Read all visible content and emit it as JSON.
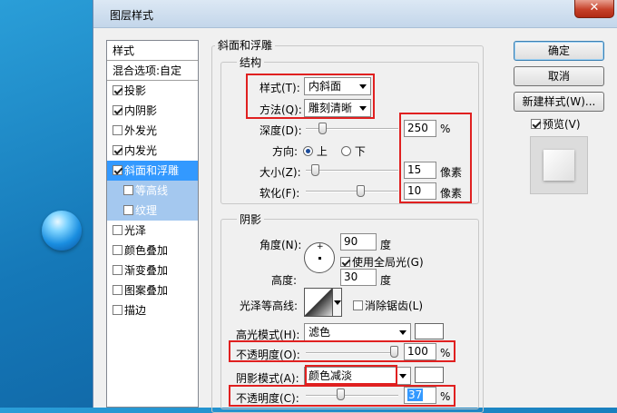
{
  "window": {
    "title": "图层样式",
    "close_label": "✕"
  },
  "style_list": {
    "header": "样式",
    "blend_label": "混合选项:自定",
    "items": [
      {
        "label": "投影",
        "checked": true
      },
      {
        "label": "内阴影",
        "checked": true
      },
      {
        "label": "外发光",
        "checked": false
      },
      {
        "label": "内发光",
        "checked": true
      },
      {
        "label": "斜面和浮雕",
        "checked": true,
        "selected": true
      },
      {
        "label": "等高线",
        "checked": false,
        "sub": true
      },
      {
        "label": "纹理",
        "checked": false,
        "sub": true
      },
      {
        "label": "光泽",
        "checked": false
      },
      {
        "label": "颜色叠加",
        "checked": false
      },
      {
        "label": "渐变叠加",
        "checked": false
      },
      {
        "label": "图案叠加",
        "checked": false
      },
      {
        "label": "描边",
        "checked": false
      }
    ]
  },
  "bevel": {
    "section_title": "斜面和浮雕",
    "structure": {
      "title": "结构",
      "style_label": "样式(T):",
      "style_value": "内斜面",
      "technique_label": "方法(Q):",
      "technique_value": "雕刻清晰",
      "depth_label": "深度(D):",
      "depth_value": "250",
      "depth_unit": "%",
      "depth_level": 0.15,
      "direction_label": "方向:",
      "dir_up": "上",
      "dir_down": "下",
      "size_label": "大小(Z):",
      "size_value": "15",
      "size_unit": "像素",
      "size_level": 0.06,
      "soften_label": "软化(F):",
      "soften_value": "10",
      "soften_unit": "像素",
      "soften_level": 0.6
    },
    "shading": {
      "title": "阴影",
      "angle_label": "角度(N):",
      "angle_value": "90",
      "angle_unit": "度",
      "global_light_label": "使用全局光(G)",
      "altitude_label": "高度:",
      "altitude_value": "30",
      "altitude_unit": "度",
      "gloss_label": "光泽等高线:",
      "antialias_label": "消除锯齿(L)",
      "highlight_mode_label": "高光模式(H):",
      "highlight_mode_value": "滤色",
      "highlight_opacity_label": "不透明度(O):",
      "highlight_opacity_value": "100",
      "highlight_opacity_unit": "%",
      "highlight_opacity_level": 1.0,
      "shadow_mode_label": "阴影模式(A):",
      "shadow_mode_value": "颜色减淡",
      "shadow_opacity_label": "不透明度(C):",
      "shadow_opacity_value": "37",
      "shadow_opacity_unit": "%",
      "shadow_opacity_level": 0.37
    }
  },
  "buttons": {
    "ok": "确定",
    "cancel": "取消",
    "new_style": "新建样式(W)...",
    "preview": "预览(V)"
  },
  "colors": {
    "highlight_red": "#e02020",
    "selection_blue": "#3399ff"
  }
}
